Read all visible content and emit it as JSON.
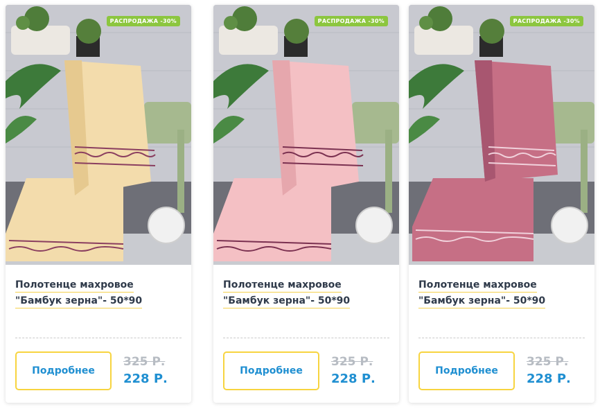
{
  "products": [
    {
      "badge": "РАСПРОДАЖА -30%",
      "title_line1": "Полотенце махровое",
      "title_line2": "\"Бамбук зерна\"- 50*90",
      "button_label": "Подробнее",
      "old_price": "325 Р.",
      "new_price": "228 Р.",
      "towel_color": "#f3dcac",
      "towel_shade": "#e6c98f"
    },
    {
      "badge": "РАСПРОДАЖА -30%",
      "title_line1": "Полотенце махровое",
      "title_line2": "\"Бамбук зерна\"- 50*90",
      "button_label": "Подробнее",
      "old_price": "325 Р.",
      "new_price": "228 Р.",
      "towel_color": "#f4c0c4",
      "towel_shade": "#e6a7ad"
    },
    {
      "badge": "РАСПРОДАЖА -30%",
      "title_line1": "Полотенце махровое",
      "title_line2": "\"Бамбук зерна\"- 50*90",
      "button_label": "Подробнее",
      "old_price": "325 Р.",
      "new_price": "228 Р.",
      "towel_color": "#c66f85",
      "towel_shade": "#a85670"
    }
  ],
  "colors": {
    "badge_green": "#8cc63f",
    "price_blue": "#1f8fd1",
    "button_border_yellow": "#f7d43f",
    "title_underline": "#f5d04c"
  }
}
